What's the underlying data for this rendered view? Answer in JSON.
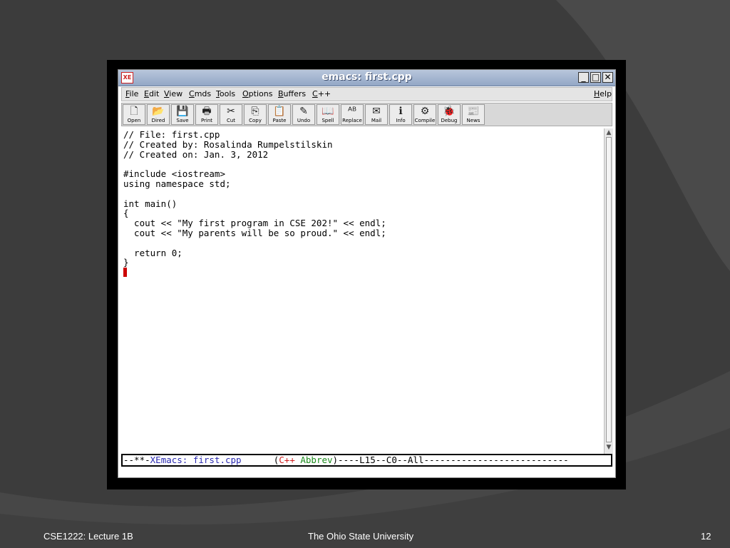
{
  "window": {
    "title": "emacs: first.cpp",
    "icon_text": "XE",
    "controls": {
      "minimize": "_",
      "maximize": "□",
      "close": "✕"
    }
  },
  "menubar": {
    "items": [
      {
        "prefix": "",
        "underline": "F",
        "rest": "ile"
      },
      {
        "prefix": "",
        "underline": "E",
        "rest": "dit"
      },
      {
        "prefix": "",
        "underline": "V",
        "rest": "iew"
      },
      {
        "prefix": "",
        "underline": "C",
        "rest": "mds"
      },
      {
        "prefix": "",
        "underline": "T",
        "rest": "ools"
      },
      {
        "prefix": "",
        "underline": "O",
        "rest": "ptions"
      },
      {
        "prefix": "",
        "underline": "B",
        "rest": "uffers"
      },
      {
        "prefix": "",
        "underline": "C",
        "rest": "++"
      }
    ],
    "help": {
      "underline": "H",
      "rest": "elp"
    }
  },
  "toolbar": {
    "buttons": [
      {
        "label": "Open",
        "icon": "document-icon",
        "glyph": "🗋"
      },
      {
        "label": "Dired",
        "icon": "folder-icon",
        "glyph": "📂"
      },
      {
        "label": "Save",
        "icon": "floppy-icon",
        "glyph": "💾"
      },
      {
        "label": "Print",
        "icon": "printer-icon",
        "glyph": "🖶"
      },
      {
        "label": "Cut",
        "icon": "scissors-icon",
        "glyph": "✂"
      },
      {
        "label": "Copy",
        "icon": "copy-icon",
        "glyph": "⎘"
      },
      {
        "label": "Paste",
        "icon": "clipboard-icon",
        "glyph": "📋"
      },
      {
        "label": "Undo",
        "icon": "eraser-icon",
        "glyph": "✎"
      },
      {
        "label": "Spell",
        "icon": "spellbook-icon",
        "glyph": "📖"
      },
      {
        "label": "Replace",
        "icon": "replace-icon",
        "glyph": "ᴬᴮ"
      },
      {
        "label": "Mail",
        "icon": "mailbox-icon",
        "glyph": "✉"
      },
      {
        "label": "Info",
        "icon": "info-icon",
        "glyph": "ℹ"
      },
      {
        "label": "Compile",
        "icon": "gears-icon",
        "glyph": "⚙"
      },
      {
        "label": "Debug",
        "icon": "debug-icon",
        "glyph": "🐞"
      },
      {
        "label": "News",
        "icon": "news-icon",
        "glyph": "📰"
      }
    ]
  },
  "editor": {
    "lines": [
      "// File: first.cpp",
      "// Created by: Rosalinda Rumpelstilskin",
      "// Created on: Jan. 3, 2012",
      "",
      "#include <iostream>",
      "using namespace std;",
      "",
      "int main()",
      "{",
      "  cout << \"My first program in CSE 202!\" << endl;",
      "  cout << \"My parents will be so proud.\" << endl;",
      "",
      "  return 0;",
      "}"
    ]
  },
  "modeline": {
    "prefix": "--**-",
    "buffer": "XEmacs: first.cpp",
    "gap": "      (",
    "mode_major": "C++",
    "space": " ",
    "mode_minor": "Abbrev",
    "suffix": ")----L15--C0--All---------------------------"
  },
  "colors": {
    "modeline_buffer": "#2a2ab0",
    "mode_major": "#d02020",
    "mode_minor": "#1c8a1c"
  },
  "footer": {
    "left": "CSE1222: Lecture 1B",
    "center": "The Ohio State University",
    "right": "12"
  }
}
